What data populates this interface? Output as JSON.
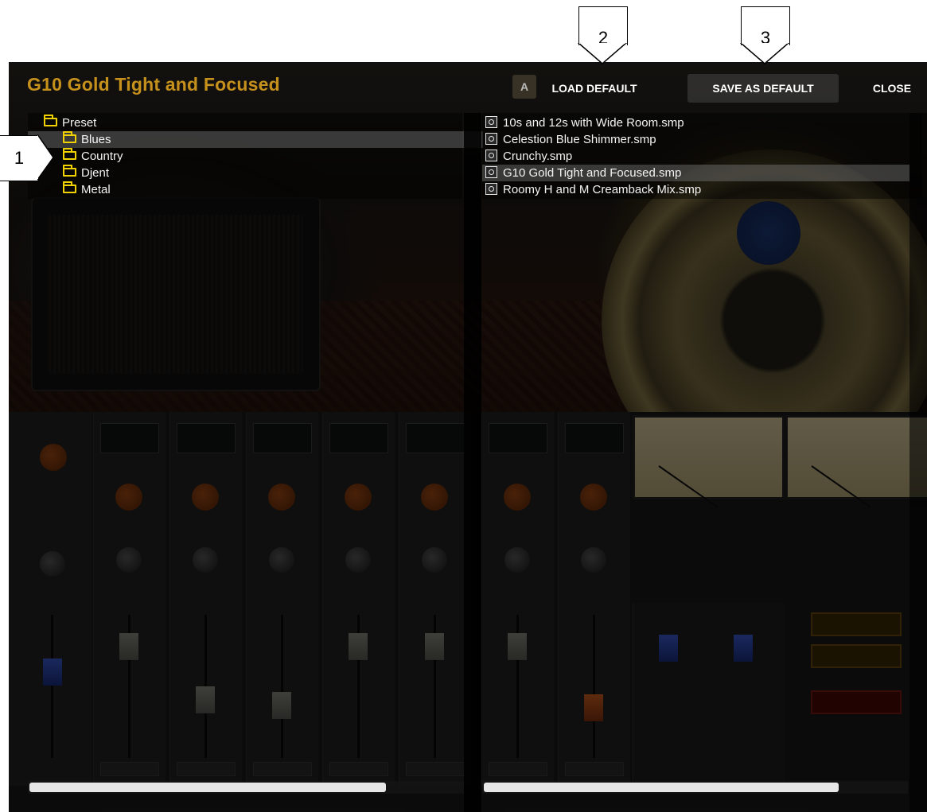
{
  "dialog": {
    "title": "G10 Gold Tight and Focused",
    "ab_label": "A",
    "load_default": "LOAD DEFAULT",
    "save_as_default": "SAVE AS DEFAULT",
    "close": "CLOSE"
  },
  "tree": {
    "root": "Preset",
    "folders": [
      "Blues",
      "Country",
      "Djent",
      "Metal"
    ],
    "highlighted": "Blues"
  },
  "files": {
    "items": [
      "10s and 12s with Wide Room.smp",
      "Celestion Blue Shimmer.smp",
      "Crunchy.smp",
      "G10 Gold Tight and Focused.smp",
      "Roomy H and M Creamback Mix.smp"
    ],
    "selected": "G10 Gold Tight and Focused.smp"
  },
  "callouts": [
    "1",
    "2",
    "3"
  ],
  "icons": {
    "folder": "folder-icon",
    "preset_file": "preset-file-icon"
  },
  "colors": {
    "title": "#c6901c",
    "folder": "#f2d100",
    "text": "#f4f4f4"
  }
}
